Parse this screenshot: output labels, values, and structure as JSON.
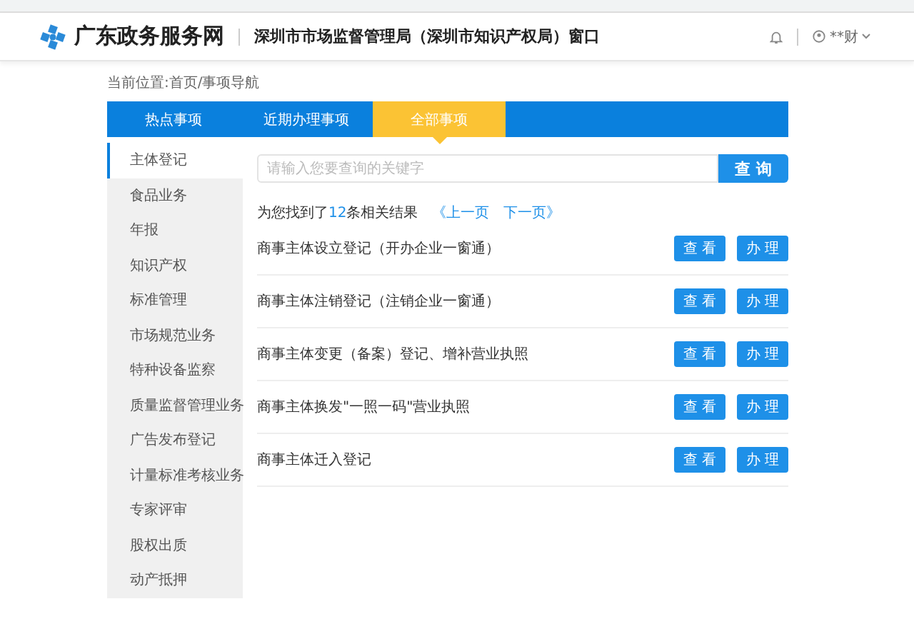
{
  "header": {
    "site_name": "广东政务服务网",
    "window_title": "深圳市市场监督管理局（深圳市知识产权局）窗口",
    "user": "**财"
  },
  "breadcrumb": "当前位置:首页/事项导航",
  "tabs": [
    {
      "label": "热点事项",
      "selected": false
    },
    {
      "label": "近期办理事项",
      "selected": false
    },
    {
      "label": "全部事项",
      "selected": true
    }
  ],
  "sidebar": {
    "items": [
      {
        "label": "主体登记",
        "selected": true
      },
      {
        "label": "食品业务",
        "selected": false
      },
      {
        "label": "年报",
        "selected": false
      },
      {
        "label": "知识产权",
        "selected": false
      },
      {
        "label": "标准管理",
        "selected": false
      },
      {
        "label": "市场规范业务",
        "selected": false
      },
      {
        "label": "特种设备监察",
        "selected": false
      },
      {
        "label": "质量监督管理业务",
        "selected": false
      },
      {
        "label": "广告发布登记",
        "selected": false
      },
      {
        "label": "计量标准考核业务",
        "selected": false
      },
      {
        "label": "专家评审",
        "selected": false
      },
      {
        "label": "股权出质",
        "selected": false
      },
      {
        "label": "动产抵押",
        "selected": false
      }
    ]
  },
  "search": {
    "placeholder": "请输入您要查询的关键字",
    "button": "查 询"
  },
  "results": {
    "prefix": "为您找到了",
    "count": "12",
    "suffix": "条相关结果",
    "prev": "《上一页",
    "next": "下一页》"
  },
  "items": [
    {
      "title": "商事主体设立登记（开办企业一窗通）",
      "view": "查 看",
      "handle": "办 理"
    },
    {
      "title": "商事主体注销登记（注销企业一窗通）",
      "view": "查 看",
      "handle": "办 理"
    },
    {
      "title": "商事主体变更（备案）登记、增补营业执照",
      "view": "查 看",
      "handle": "办 理"
    },
    {
      "title": "商事主体换发\"一照一码\"营业执照",
      "view": "查 看",
      "handle": "办 理"
    },
    {
      "title": "商事主体迁入登记",
      "view": "查 看",
      "handle": "办 理"
    }
  ]
}
